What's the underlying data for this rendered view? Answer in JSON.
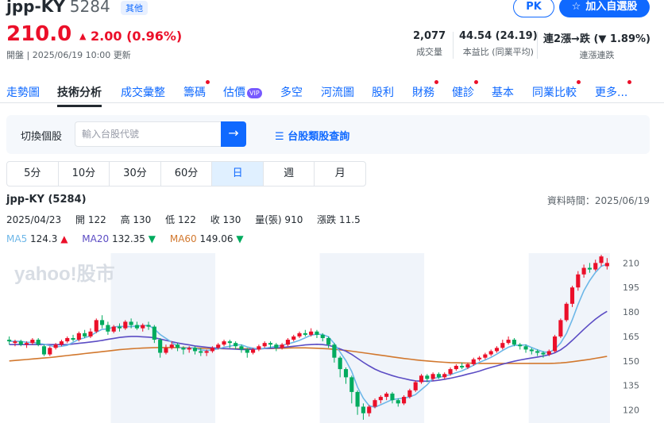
{
  "header": {
    "name": "jpp-KY",
    "code": "5284",
    "market": "其他",
    "pk_label": "PK",
    "watch_label": "加入自選股",
    "price": "210.0",
    "change": "2.00 (0.96%)",
    "market_time": "開盤 | 2025/06/19 10:00 更新"
  },
  "stats": [
    {
      "value": "2,077",
      "label": "成交量"
    },
    {
      "value": "44.54 (24.19)",
      "label": "本益比 (同業平均)"
    },
    {
      "value_prefix": "連2漲→跌 (",
      "value_change": "▼ 1.89%",
      "value_suffix": ")",
      "label": "連漲連跌"
    }
  ],
  "tabs": [
    {
      "label": "走勢圖",
      "dot": false
    },
    {
      "label": "技術分析",
      "active": true,
      "dot": false
    },
    {
      "label": "成交彙整",
      "dot": false
    },
    {
      "label": "籌碼",
      "dot": true
    },
    {
      "label": "估價",
      "vip": "VIP",
      "dot": false
    },
    {
      "label": "多空",
      "dot": false
    },
    {
      "label": "河流圖",
      "dot": false
    },
    {
      "label": "股利",
      "dot": false
    },
    {
      "label": "財務",
      "dot": true
    },
    {
      "label": "健診",
      "dot": true
    },
    {
      "label": "基本",
      "dot": false
    },
    {
      "label": "同業比較",
      "dot": true
    },
    {
      "label": "更多...",
      "dot": true
    }
  ],
  "search": {
    "label": "切換個股",
    "placeholder": "輸入台股代號",
    "category_link": "台股類股查詢"
  },
  "periods": [
    "5分",
    "10分",
    "30分",
    "60分",
    "日",
    "週",
    "月"
  ],
  "active_period": "日",
  "chart_header": {
    "title": "jpp-KY (5284)",
    "data_time": "資料時間：2025/06/19"
  },
  "ohlc": {
    "date": "2025/04/23",
    "open": "開 122",
    "high": "高 130",
    "low": "低 122",
    "close": "收 130",
    "volume": "量(張) 910",
    "change": "漲跌 11.5"
  },
  "ma": [
    {
      "label": "MA5",
      "value": "124.3",
      "dir": "▲",
      "color": "#6db7e8"
    },
    {
      "label": "MA20",
      "value": "132.35",
      "dir": "▼",
      "color": "#5b4cc4"
    },
    {
      "label": "MA60",
      "value": "149.06",
      "dir": "▼",
      "color": "#d2782e"
    }
  ],
  "watermark": "yahoo!股市",
  "colors": {
    "accent": "#0f69ff",
    "up": "#eb0f29",
    "down": "#00ab5e"
  },
  "chart_data": {
    "type": "candlestick",
    "ylim": [
      112,
      216
    ],
    "y_ticks": [
      120,
      135,
      150,
      165,
      180,
      195,
      210
    ],
    "candles": [
      [
        163,
        162,
        165,
        160
      ],
      [
        161,
        162,
        163,
        159
      ],
      [
        162,
        160,
        163,
        159
      ],
      [
        160,
        161,
        162,
        158
      ],
      [
        161,
        163,
        164,
        160
      ],
      [
        163,
        160,
        164,
        159
      ],
      [
        159,
        154,
        160,
        153
      ],
      [
        154,
        158,
        159,
        153
      ],
      [
        158,
        160,
        161,
        157
      ],
      [
        160,
        162,
        163,
        159
      ],
      [
        162,
        164,
        165,
        161
      ],
      [
        164,
        163,
        166,
        162
      ],
      [
        163,
        167,
        168,
        162
      ],
      [
        167,
        165,
        169,
        164
      ],
      [
        165,
        168,
        170,
        164
      ],
      [
        168,
        175,
        176,
        167
      ],
      [
        175,
        172,
        178,
        170
      ],
      [
        172,
        168,
        174,
        166
      ],
      [
        168,
        171,
        172,
        167
      ],
      [
        171,
        170,
        173,
        168
      ],
      [
        170,
        174,
        175,
        169
      ],
      [
        174,
        172,
        176,
        170
      ],
      [
        172,
        170,
        174,
        169
      ],
      [
        170,
        172,
        173,
        168
      ],
      [
        172,
        171,
        174,
        169
      ],
      [
        171,
        163,
        172,
        161
      ],
      [
        163,
        155,
        164,
        152
      ],
      [
        155,
        158,
        160,
        154
      ],
      [
        158,
        160,
        162,
        157
      ],
      [
        160,
        158,
        161,
        156
      ],
      [
        158,
        157,
        159,
        154
      ],
      [
        157,
        158,
        159,
        155
      ],
      [
        158,
        156,
        159,
        154
      ],
      [
        156,
        155,
        158,
        153
      ],
      [
        155,
        156,
        157,
        153
      ],
      [
        156,
        158,
        159,
        155
      ],
      [
        158,
        160,
        161,
        157
      ],
      [
        160,
        162,
        163,
        159
      ],
      [
        162,
        161,
        163,
        158
      ],
      [
        161,
        159,
        162,
        157
      ],
      [
        159,
        157,
        160,
        155
      ],
      [
        157,
        155,
        158,
        152
      ],
      [
        155,
        157,
        158,
        154
      ],
      [
        157,
        159,
        160,
        156
      ],
      [
        159,
        161,
        162,
        158
      ],
      [
        161,
        160,
        162,
        158
      ],
      [
        160,
        158,
        161,
        156
      ],
      [
        158,
        160,
        161,
        157
      ],
      [
        160,
        163,
        164,
        159
      ],
      [
        163,
        165,
        166,
        162
      ],
      [
        165,
        167,
        168,
        164
      ],
      [
        167,
        166,
        169,
        165
      ],
      [
        166,
        168,
        170,
        165
      ],
      [
        168,
        166,
        169,
        164
      ],
      [
        166,
        164,
        167,
        162
      ],
      [
        164,
        160,
        165,
        158
      ],
      [
        160,
        152,
        161,
        149
      ],
      [
        152,
        145,
        153,
        140
      ],
      [
        145,
        140,
        146,
        136
      ],
      [
        140,
        131,
        141,
        124
      ],
      [
        131,
        122,
        132,
        117
      ],
      [
        122,
        118,
        124,
        114
      ],
      [
        118,
        122,
        123,
        116
      ],
      [
        122,
        126,
        127,
        121
      ],
      [
        126,
        128,
        129,
        124
      ],
      [
        128,
        130,
        131,
        126
      ],
      [
        130,
        126,
        131,
        124
      ],
      [
        126,
        124,
        127,
        122
      ],
      [
        124,
        128,
        129,
        123
      ],
      [
        128,
        132,
        133,
        127
      ],
      [
        132,
        137,
        138,
        131
      ],
      [
        137,
        141,
        142,
        136
      ],
      [
        141,
        139,
        142,
        137
      ],
      [
        139,
        142,
        143,
        138
      ],
      [
        142,
        140,
        143,
        139
      ],
      [
        140,
        142,
        143,
        139
      ],
      [
        142,
        145,
        146,
        141
      ],
      [
        145,
        147,
        148,
        144
      ],
      [
        147,
        146,
        149,
        145
      ],
      [
        146,
        148,
        149,
        145
      ],
      [
        148,
        151,
        152,
        147
      ],
      [
        151,
        152,
        153,
        150
      ],
      [
        152,
        154,
        155,
        151
      ],
      [
        154,
        156,
        157,
        153
      ],
      [
        156,
        158,
        159,
        155
      ],
      [
        158,
        161,
        163,
        157
      ],
      [
        161,
        163,
        165,
        160
      ],
      [
        163,
        160,
        164,
        159
      ],
      [
        160,
        159,
        161,
        157
      ],
      [
        159,
        157,
        160,
        155
      ],
      [
        157,
        156,
        158,
        154
      ],
      [
        156,
        155,
        157,
        153
      ],
      [
        155,
        154,
        156,
        152
      ],
      [
        154,
        156,
        157,
        153
      ],
      [
        156,
        165,
        166,
        155
      ],
      [
        165,
        175,
        176,
        164
      ],
      [
        175,
        185,
        186,
        174
      ],
      [
        185,
        195,
        196,
        183
      ],
      [
        195,
        203,
        205,
        193
      ],
      [
        203,
        207,
        209,
        201
      ],
      [
        207,
        206,
        210,
        204
      ],
      [
        206,
        210,
        212,
        205
      ],
      [
        210,
        214,
        215,
        208
      ],
      [
        208,
        210,
        213,
        206
      ]
    ],
    "ma5": [
      162,
      162,
      162,
      161.4,
      161.4,
      160.8,
      160.2,
      159.4,
      158.6,
      159,
      159.6,
      161.4,
      163.2,
      164.2,
      165.4,
      167.6,
      169.4,
      169.6,
      170.8,
      171.2,
      171,
      171,
      171.4,
      171.6,
      171.8,
      169.6,
      166.2,
      163.8,
      161.4,
      158.8,
      157.6,
      158.2,
      157.8,
      156.8,
      156.4,
      156.8,
      157.4,
      158.4,
      159,
      159.8,
      159.8,
      158.6,
      157.8,
      157.4,
      157.8,
      158.4,
      159,
      159.6,
      160.4,
      161.4,
      162.6,
      164.2,
      165.8,
      166.4,
      166.2,
      164.8,
      160.6,
      155.4,
      150.2,
      143.6,
      134,
      127.2,
      122.6,
      121.6,
      123.2,
      124.8,
      126.4,
      126.8,
      127.2,
      128,
      129.4,
      132.4,
      135.4,
      139.4,
      139.8,
      140.8,
      141.6,
      142.8,
      144,
      145.6,
      147.4,
      149.2,
      150.6,
      152.2,
      154.2,
      156.4,
      158.4,
      159.6,
      159.6,
      159.8,
      158.2,
      156.8,
      155.6,
      155.2,
      157.2,
      161,
      166.8,
      175.2,
      184.6,
      193,
      199.2,
      204.2,
      208,
      209.2
    ],
    "ma20": [
      160,
      160,
      160,
      160,
      160,
      160,
      160,
      160,
      160,
      160,
      160,
      160.4,
      160.8,
      161.2,
      161.6,
      162,
      162.6,
      163.2,
      163.8,
      164.4,
      164.8,
      165,
      165,
      164.8,
      164.6,
      164.2,
      163.4,
      162.6,
      161.8,
      161,
      160.4,
      159.8,
      159.2,
      158.8,
      158.4,
      158,
      157.8,
      157.6,
      157.4,
      157.2,
      157,
      157,
      157.2,
      157.4,
      157.6,
      157.8,
      158,
      158.2,
      158.6,
      159,
      159.4,
      159.8,
      160,
      160.2,
      160,
      159.6,
      158.6,
      157.4,
      156,
      154,
      151.6,
      149.2,
      147,
      145,
      143.4,
      142.2,
      141,
      140,
      139.2,
      138.4,
      137.8,
      137.6,
      137.6,
      137.8,
      138.2,
      138.8,
      139.4,
      140.2,
      141,
      142,
      142.8,
      143.8,
      145,
      146,
      147,
      148,
      149,
      149.8,
      150.6,
      151.2,
      151.8,
      152.4,
      153,
      153.8,
      155,
      156.8,
      159.4,
      162.6,
      166,
      169.4,
      172.6,
      175.6,
      178.2,
      180.4
    ],
    "ma60": [
      150,
      150.3,
      150.6,
      150.9,
      151.2,
      151.5,
      151.8,
      152.1,
      152.5,
      152.9,
      153.3,
      153.7,
      154.1,
      154.5,
      154.9,
      155.3,
      155.7,
      156.1,
      156.5,
      156.9,
      157.2,
      157.5,
      157.7,
      157.9,
      158,
      158.1,
      158.2,
      158.2,
      158.2,
      158.2,
      158.1,
      158,
      157.9,
      157.8,
      157.7,
      157.6,
      157.6,
      157.5,
      157.5,
      157.5,
      157.5,
      157.5,
      157.5,
      157.5,
      157.6,
      157.6,
      157.7,
      157.8,
      157.9,
      158,
      158,
      158,
      157.9,
      157.8,
      157.6,
      157.4,
      157.1,
      156.8,
      156.4,
      156,
      155.5,
      155,
      154.5,
      154,
      153.5,
      153,
      152.5,
      152,
      151.5,
      151.1,
      150.7,
      150.3,
      150,
      149.7,
      149.4,
      149.2,
      149,
      148.9,
      148.8,
      148.7,
      148.6,
      148.5,
      148.5,
      148.5,
      148.5,
      148.5,
      148.5,
      148.5,
      148.5,
      148.5,
      148.5,
      148.5,
      148.5,
      148.5,
      148.6,
      148.8,
      149.1,
      149.5,
      150,
      150.5,
      151,
      151.6,
      152.2,
      152.8
    ]
  }
}
